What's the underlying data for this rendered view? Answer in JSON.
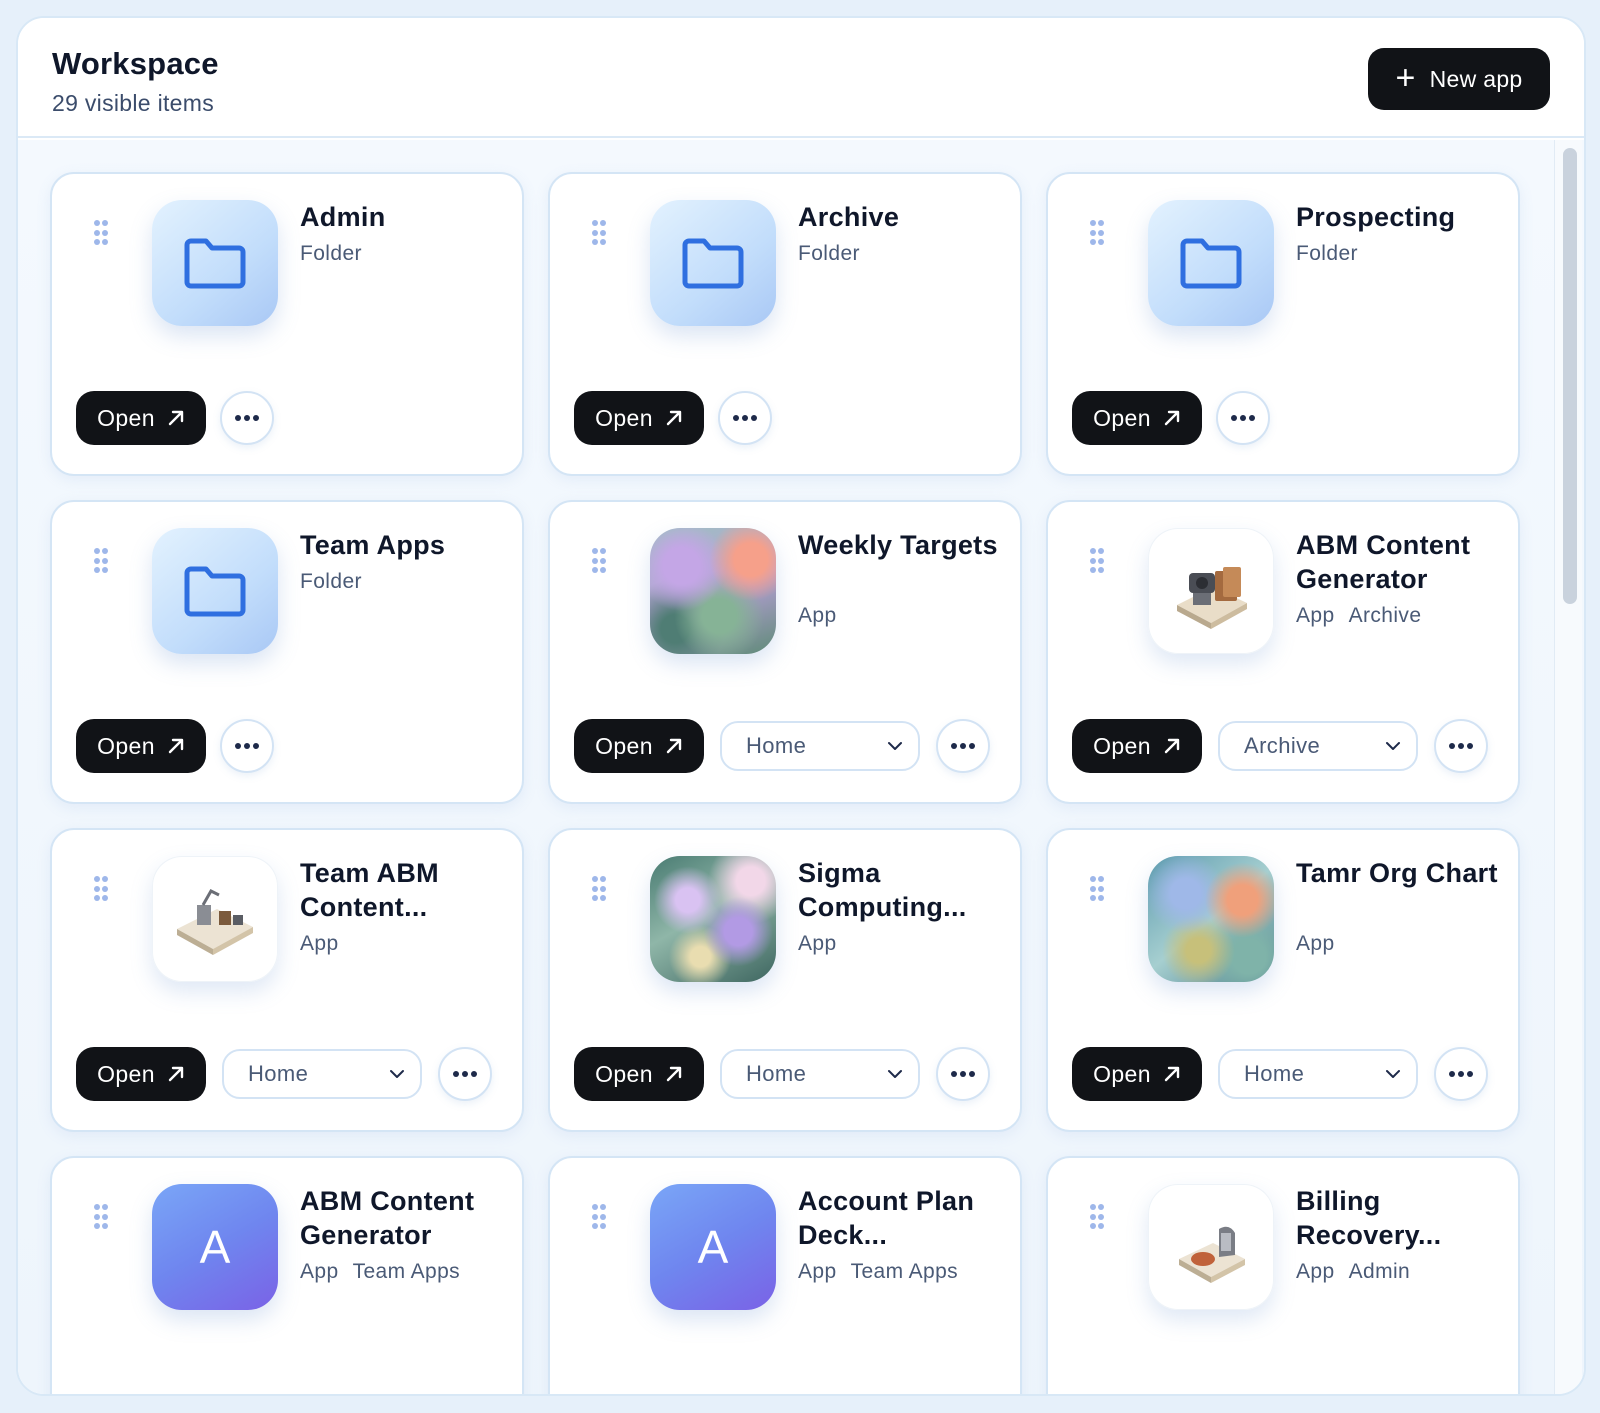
{
  "header": {
    "title": "Workspace",
    "subtitle": "29 visible items",
    "new_app_label": "New app"
  },
  "common": {
    "open_label": "Open"
  },
  "cards": [
    {
      "name": "Admin",
      "meta": [
        "Folder"
      ],
      "thumb": "folder",
      "select": null
    },
    {
      "name": "Archive",
      "meta": [
        "Folder"
      ],
      "thumb": "folder",
      "select": null
    },
    {
      "name": "Prospecting",
      "meta": [
        "Folder"
      ],
      "thumb": "folder",
      "select": null
    },
    {
      "name": "Team Apps",
      "meta": [
        "Folder"
      ],
      "thumb": "folder",
      "select": null
    },
    {
      "name": "Weekly Targets",
      "meta": [
        "App"
      ],
      "thumb": "painting",
      "select": "Home"
    },
    {
      "name": "ABM Content Generator",
      "meta": [
        "App",
        "Archive"
      ],
      "thumb": "isometric-machine",
      "select": "Archive"
    },
    {
      "name": "Team ABM Content...",
      "meta": [
        "App"
      ],
      "thumb": "isometric-machine",
      "select": "Home"
    },
    {
      "name": "Sigma Computing...",
      "meta": [
        "App"
      ],
      "thumb": "painting",
      "select": "Home"
    },
    {
      "name": "Tamr Org Chart",
      "meta": [
        "App"
      ],
      "thumb": "painting",
      "select": "Home"
    },
    {
      "name": "ABM Content Generator",
      "meta": [
        "App",
        "Team Apps"
      ],
      "thumb": "letter",
      "letter": "A",
      "select": null
    },
    {
      "name": "Account Plan Deck...",
      "meta": [
        "App",
        "Team Apps"
      ],
      "thumb": "letter",
      "letter": "A",
      "select": null
    },
    {
      "name": "Billing Recovery...",
      "meta": [
        "App",
        "Admin"
      ],
      "thumb": "isometric-machine",
      "select": null
    }
  ],
  "colors": {
    "accent_dark": "#111317",
    "folder_icon": "#2f6fe0",
    "grip": "#9eb7ea",
    "card_border": "#d4e5f5"
  }
}
